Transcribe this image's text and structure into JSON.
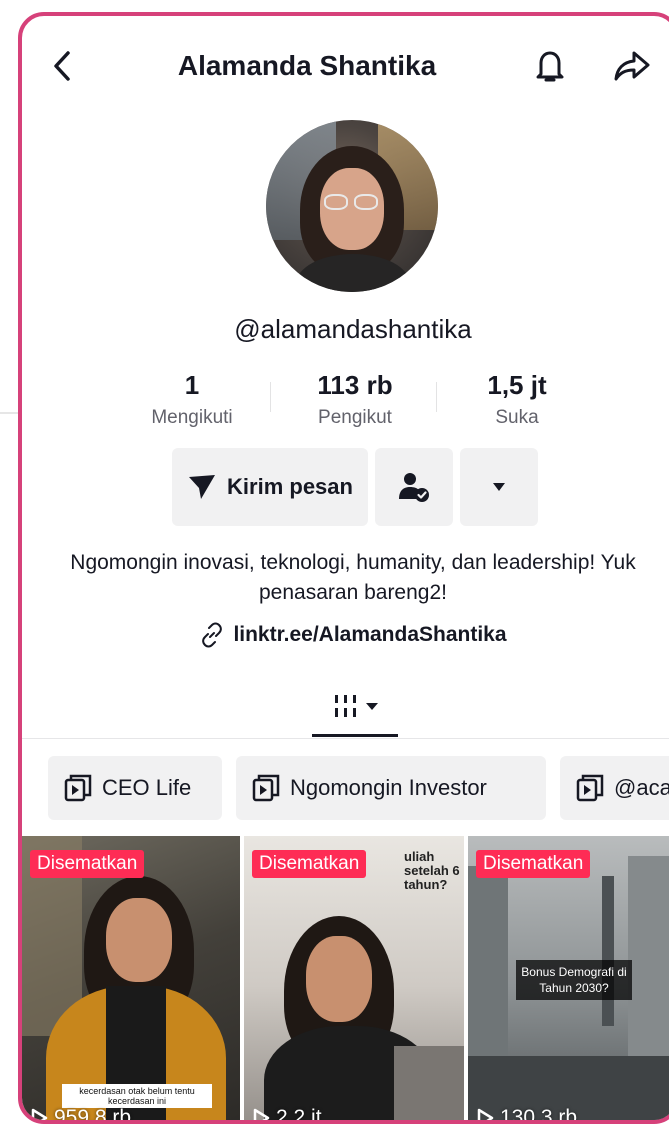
{
  "header": {
    "title": "Alamanda Shantika"
  },
  "profile": {
    "username": "@alamandashantika",
    "bio": "Ngomongin inovasi, teknologi, humanity, dan leadership! Yuk penasaran bareng2!",
    "link": "linktr.ee/AlamandaShantika"
  },
  "stats": [
    {
      "value": "1",
      "label": "Mengikuti"
    },
    {
      "value": "113 rb",
      "label": "Pengikut"
    },
    {
      "value": "1,5 jt",
      "label": "Suka"
    }
  ],
  "actions": {
    "message_label": "Kirim pesan"
  },
  "playlists": [
    {
      "label": "CEO Life"
    },
    {
      "label": "Ngomongin Investor"
    },
    {
      "label": "@aca"
    }
  ],
  "videos": [
    {
      "badge": "Disematkan",
      "views": "959,8 rb",
      "caption": "kecerdasan otak belum tentu kecerdasan ini"
    },
    {
      "badge": "Disematkan",
      "views": "2,2 jt",
      "caption": "uliah setelah 6 tahun?"
    },
    {
      "badge": "Disematkan",
      "views": "130,3 rb",
      "caption": "Bonus Demografi di Tahun 2030?"
    }
  ],
  "colors": {
    "frame": "#d6417a",
    "badge": "#fe2c55",
    "text": "#161823",
    "muted": "#62626b",
    "button_bg": "#f1f1f2"
  },
  "icons": {
    "back": "chevron-left-icon",
    "bell": "bell-icon",
    "share": "share-arrow-icon",
    "message": "send-icon",
    "follow": "user-check-icon",
    "more": "caret-down-icon",
    "link": "link-icon",
    "grid": "grid-icon",
    "playlist": "playlist-icon",
    "play": "play-icon"
  }
}
